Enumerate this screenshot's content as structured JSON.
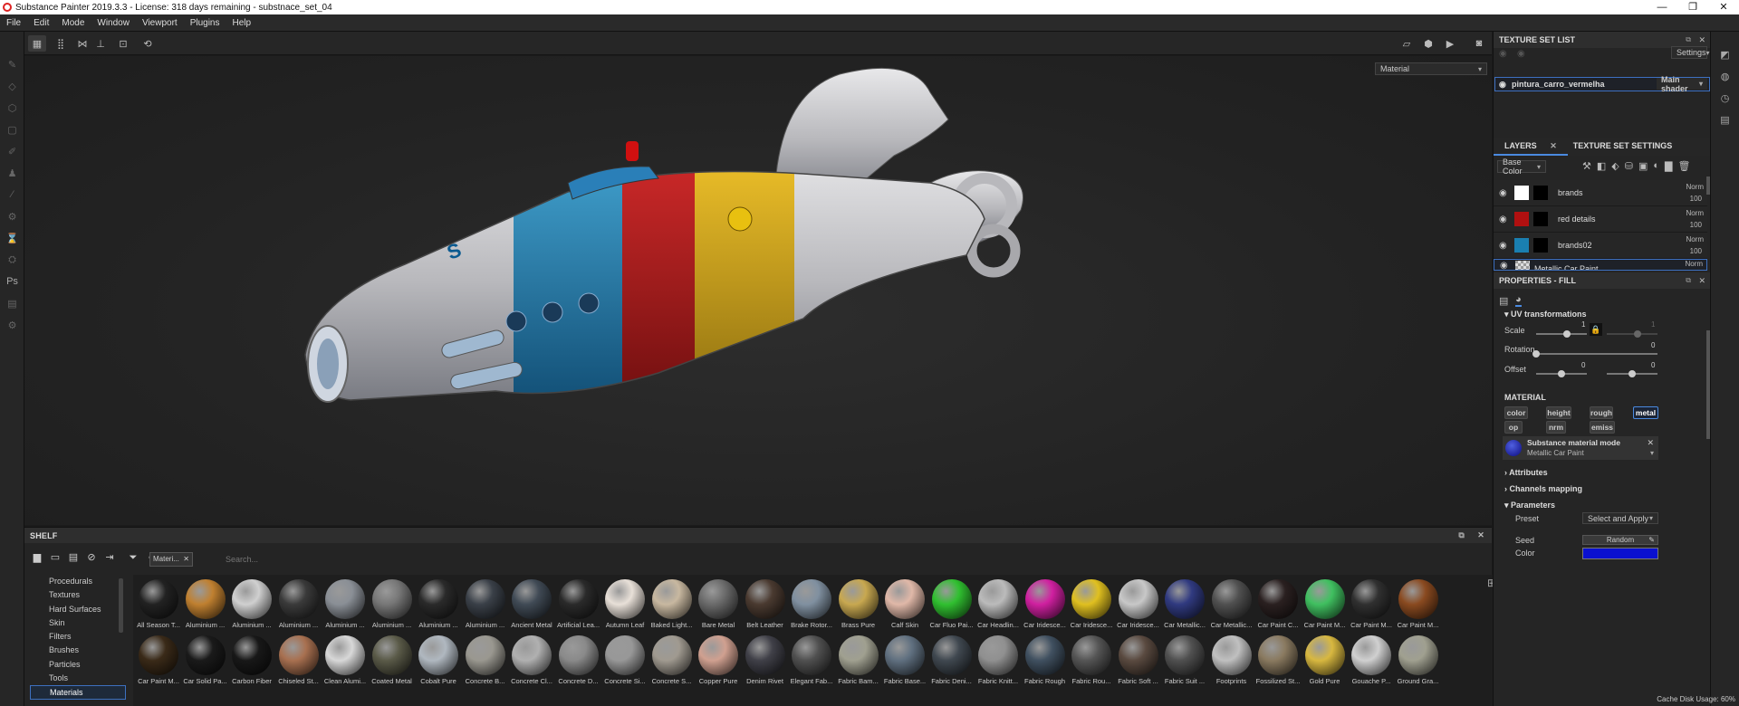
{
  "titlebar": {
    "title": "Substance Painter 2019.3.3 - License: 318 days remaining - substnace_set_04",
    "min": "—",
    "max": "❐",
    "close": "✕"
  },
  "menu": [
    "File",
    "Edit",
    "Mode",
    "Window",
    "Viewport",
    "Plugins",
    "Help"
  ],
  "viewport": {
    "mode_select": "Material"
  },
  "texture_set_list": {
    "title": "TEXTURE SET LIST",
    "settings_label": "Settings",
    "set_name": "pintura_carro_vermelha",
    "shader": "Main shader"
  },
  "layers_tab": {
    "tab_layers": "LAYERS",
    "tab_tss": "TEXTURE SET SETTINGS",
    "channel": "Base Color"
  },
  "layers": [
    {
      "name": "brands",
      "blend": "Norm",
      "opacity": "100",
      "thumb": "#ffffff"
    },
    {
      "name": "red details",
      "blend": "Norm",
      "opacity": "100",
      "thumb": "#b01010"
    },
    {
      "name": "brands02",
      "blend": "Norm",
      "opacity": "100",
      "thumb": "#1a7fb0"
    },
    {
      "name": "Metallic Car Paint",
      "blend": "Norm",
      "opacity": "",
      "thumb": "#d8d8d8"
    }
  ],
  "properties": {
    "title": "PROPERTIES - FILL",
    "uv_title": "UV transformations",
    "scale_label": "Scale",
    "scale_val": "1",
    "scale_val2": "1",
    "rotation_label": "Rotation",
    "rotation_val": "0",
    "offset_label": "Offset",
    "offset_val1": "0",
    "offset_val2": "0",
    "material_title": "MATERIAL",
    "chips": [
      "color",
      "height",
      "rough",
      "metal",
      "op",
      "nrm",
      "emiss"
    ],
    "sbs_mode_title": "Substance material mode",
    "sbs_mode_value": "Metallic Car Paint",
    "attributes": "Attributes",
    "channels_mapping": "Channels mapping",
    "parameters": "Parameters",
    "preset_label": "Preset",
    "preset_value": "Select and Apply",
    "seed_label": "Seed",
    "seed_button": "Random",
    "color_label": "Color",
    "color_value": "#0a10d0"
  },
  "shelf": {
    "title": "SHELF",
    "filter_tag": "Materi...",
    "search_placeholder": "Search...",
    "categories": [
      "Procedurals",
      "Textures",
      "Hard Surfaces",
      "Skin",
      "Filters",
      "Brushes",
      "Particles",
      "Tools",
      "Materials"
    ],
    "row1": [
      {
        "label": "All Season T...",
        "color": "#222"
      },
      {
        "label": "Aluminium ...",
        "color": "#c08030"
      },
      {
        "label": "Aluminium ...",
        "color": "#d0d0d0"
      },
      {
        "label": "Aluminium ...",
        "color": "#3a3a3a"
      },
      {
        "label": "Aluminium ...",
        "color": "#8a8f96"
      },
      {
        "label": "Aluminium ...",
        "color": "#777"
      },
      {
        "label": "Aluminium ...",
        "color": "#2a2a2a"
      },
      {
        "label": "Aluminium ...",
        "color": "#3a4048"
      },
      {
        "label": "Ancient Metal",
        "color": "#404a55"
      },
      {
        "label": "Artificial Lea...",
        "color": "#2a2a2a"
      },
      {
        "label": "Autumn Leaf",
        "color": "#e8e0d8"
      },
      {
        "label": "Baked Light...",
        "color": "#c8b8a0"
      },
      {
        "label": "Bare Metal",
        "color": "#6a6a6a"
      },
      {
        "label": "Belt Leather",
        "color": "#4a3a30"
      },
      {
        "label": "Brake Rotor...",
        "color": "#8090a0"
      },
      {
        "label": "Brass Pure",
        "color": "#c8a850"
      },
      {
        "label": "Calf Skin",
        "color": "#e0b8a8"
      },
      {
        "label": "Car Fluo Pai...",
        "color": "#30c030"
      },
      {
        "label": "Car Headlin...",
        "color": "#bbbbbb"
      },
      {
        "label": "Car Iridesce...",
        "color": "#d020a0"
      },
      {
        "label": "Car Iridesce...",
        "color": "#e0c020"
      },
      {
        "label": "Car Iridesce...",
        "color": "#c8c8c8"
      },
      {
        "label": "Car Metallic...",
        "color": "#303a80"
      },
      {
        "label": "Car Metallic...",
        "color": "#505050"
      },
      {
        "label": "Car Paint C...",
        "color": "#2a2020"
      },
      {
        "label": "Car Paint M...",
        "color": "#40c060"
      },
      {
        "label": "Car Paint M...",
        "color": "#303030"
      },
      {
        "label": "Car Paint M...",
        "color": "#8a4a20"
      }
    ],
    "row2": [
      {
        "label": "Car Paint M...",
        "color": "#3a2a18"
      },
      {
        "label": "Car Solid Pa...",
        "color": "#1a1a1a"
      },
      {
        "label": "Carbon Fiber",
        "color": "#181818"
      },
      {
        "label": "Chiseled St...",
        "color": "#a87050"
      },
      {
        "label": "Clean Alumi...",
        "color": "#d8d8d8"
      },
      {
        "label": "Coated Metal",
        "color": "#5a5a48"
      },
      {
        "label": "Cobalt Pure",
        "color": "#b0b8c0"
      },
      {
        "label": "Concrete B...",
        "color": "#9a9890"
      },
      {
        "label": "Concrete Cl...",
        "color": "#b0b0b0"
      },
      {
        "label": "Concrete D...",
        "color": "#8a8a8a"
      },
      {
        "label": "Concrete Si...",
        "color": "#989898"
      },
      {
        "label": "Concrete S...",
        "color": "#a09a90"
      },
      {
        "label": "Copper Pure",
        "color": "#d0a090"
      },
      {
        "label": "Denim Rivet",
        "color": "#404048"
      },
      {
        "label": "Elegant Fab...",
        "color": "#505050"
      },
      {
        "label": "Fabric Bam...",
        "color": "#a0a090"
      },
      {
        "label": "Fabric Base...",
        "color": "#607080"
      },
      {
        "label": "Fabric Deni...",
        "color": "#404850"
      },
      {
        "label": "Fabric Knitt...",
        "color": "#909090"
      },
      {
        "label": "Fabric Rough",
        "color": "#405060"
      },
      {
        "label": "Fabric Rou...",
        "color": "#555"
      },
      {
        "label": "Fabric Soft ...",
        "color": "#5a4a40"
      },
      {
        "label": "Fabric Suit ...",
        "color": "#505050"
      },
      {
        "label": "Footprints",
        "color": "#c0c0c0"
      },
      {
        "label": "Fossilized St...",
        "color": "#8a7a60"
      },
      {
        "label": "Gold Pure",
        "color": "#d8b840"
      },
      {
        "label": "Gouache P...",
        "color": "#d0d0d0"
      },
      {
        "label": "Ground Gra...",
        "color": "#a0a090"
      }
    ]
  },
  "status": {
    "cache": "Cache Disk Usage:  60%"
  }
}
